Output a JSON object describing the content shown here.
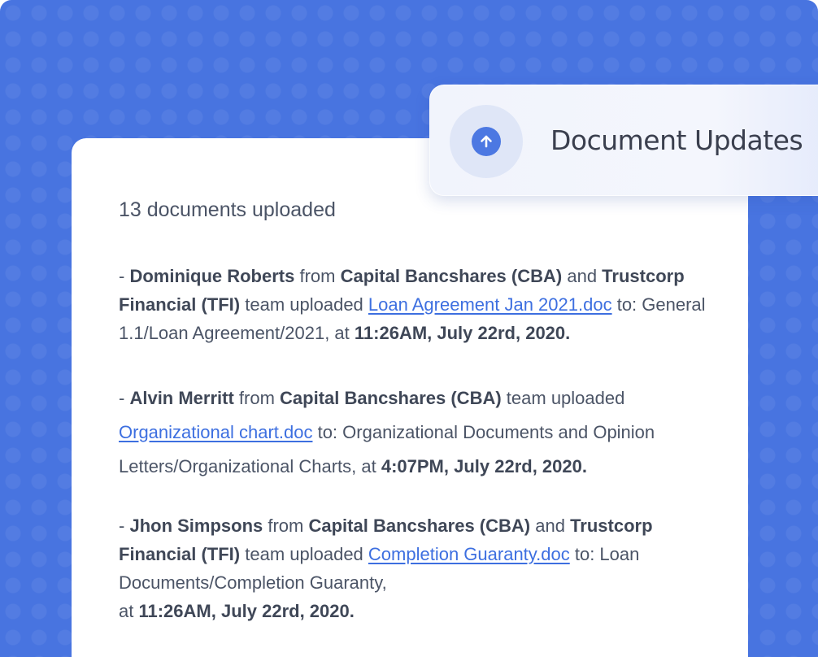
{
  "header": {
    "title": "Document Updates",
    "icon": "arrow-up-circle-icon",
    "accent_color": "#4c78e2"
  },
  "summary": "13 documents uploaded",
  "entries": [
    {
      "prefix": "- ",
      "user": "Dominique Roberts",
      "from_word": " from ",
      "org1": "Capital Bancshares (CBA)",
      "and_word": " and ",
      "org2": "Trustcorp Financial (TFI)",
      "team_text": " team uploaded ",
      "file": "Loan Agreement Jan 2021.doc",
      "to_text": " to: General 1.1/Loan Agreement/2021, at ",
      "time": "11:26AM, July 22rd, 2020."
    },
    {
      "prefix": "- ",
      "user": "Alvin Merritt",
      "from_word": " from ",
      "org1": "Capital Bancshares (CBA)",
      "team_text": " team uploaded ",
      "file": "Organizational chart.doc",
      "to_text": " to: Organizational Documents and Opinion Letters/Organizational Charts, at ",
      "time": "4:07PM, July 22rd, 2020."
    },
    {
      "prefix": "- ",
      "user": "Jhon Simpsons",
      "from_word": " from ",
      "org1": "Capital Bancshares (CBA)",
      "and_word": " and ",
      "org2": "Trustcorp Financial (TFI)",
      "team_text": " team uploaded ",
      "file": "Completion Guaranty.doc",
      "to_text": " to: Loan Documents/Completion Guaranty,",
      "at_text": "at ",
      "time": "11:26AM, July 22rd, 2020."
    }
  ]
}
